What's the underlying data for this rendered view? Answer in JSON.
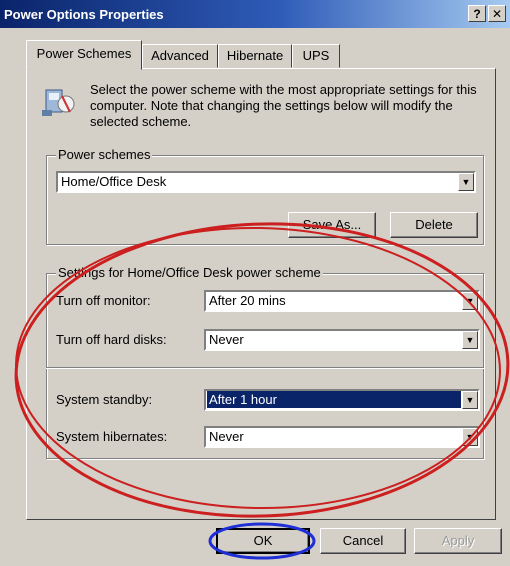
{
  "window": {
    "title": "Power Options Properties",
    "help_label": "?",
    "close_label": "x"
  },
  "tabs": [
    {
      "label": "Power Schemes",
      "active": true
    },
    {
      "label": "Advanced",
      "active": false
    },
    {
      "label": "Hibernate",
      "active": false
    },
    {
      "label": "UPS",
      "active": false
    }
  ],
  "intro_text": "Select the power scheme with the most appropriate settings for this computer. Note that changing the settings below will modify the selected scheme.",
  "power_schemes": {
    "legend": "Power schemes",
    "selected": "Home/Office Desk",
    "save_as_label": "Save As...",
    "delete_label": "Delete"
  },
  "settings": {
    "legend": "Settings for Home/Office Desk power scheme",
    "turn_off_monitor": {
      "label": "Turn off monitor:",
      "value": "After 20 mins"
    },
    "turn_off_hard_disks": {
      "label": "Turn off hard disks:",
      "value": "Never"
    },
    "system_standby": {
      "label": "System standby:",
      "value": "After 1 hour"
    },
    "system_hibernates": {
      "label": "System hibernates:",
      "value": "Never"
    }
  },
  "footer": {
    "ok_label": "OK",
    "cancel_label": "Cancel",
    "apply_label": "Apply"
  },
  "colors": {
    "titlebar_start": "#0a246a",
    "dialog_face": "#d4d0c8",
    "annotation_red": "#cc1f1f",
    "annotation_blue": "#1f2fd6",
    "selection": "#0a246a"
  }
}
